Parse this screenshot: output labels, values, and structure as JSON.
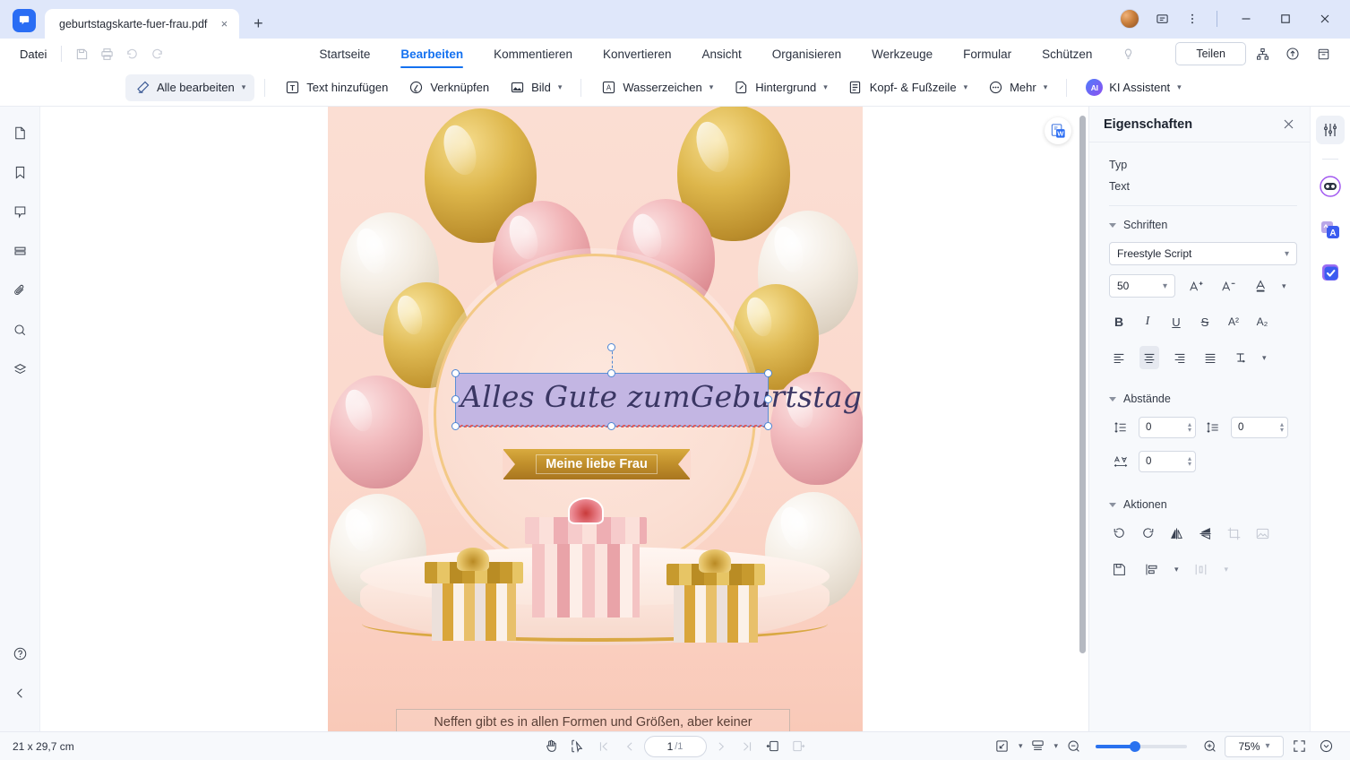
{
  "titlebar": {
    "tab_title": "geburtstagskarte-fuer-frau.pdf",
    "close_tab": "×",
    "new_tab": "+",
    "icons": [
      "avatar",
      "comment-icon",
      "more-vertical-icon",
      "minimize-icon",
      "maximize-icon",
      "close-icon"
    ]
  },
  "menubar": {
    "file_label": "Datei",
    "quick_icons": [
      "save-icon",
      "print-icon",
      "undo-icon",
      "redo-icon"
    ],
    "tabs": [
      {
        "label": "Startseite",
        "active": false
      },
      {
        "label": "Bearbeiten",
        "active": true
      },
      {
        "label": "Kommentieren",
        "active": false
      },
      {
        "label": "Konvertieren",
        "active": false
      },
      {
        "label": "Ansicht",
        "active": false
      },
      {
        "label": "Organisieren",
        "active": false
      },
      {
        "label": "Werkzeuge",
        "active": false
      },
      {
        "label": "Formular",
        "active": false
      },
      {
        "label": "Schützen",
        "active": false
      }
    ],
    "bulb_icon": "lightbulb-icon",
    "share_label": "Teilen",
    "right_icons": [
      "share-network-icon",
      "cloud-upload-icon",
      "archive-icon"
    ]
  },
  "ribbon": {
    "items": [
      {
        "label": "Alle bearbeiten",
        "icon": "edit-pencil-icon",
        "caret": true,
        "active": true
      },
      {
        "label": "Text hinzufügen",
        "icon": "add-text-icon",
        "caret": false,
        "active": false
      },
      {
        "label": "Verknüpfen",
        "icon": "link-icon",
        "caret": false,
        "active": false
      },
      {
        "label": "Bild",
        "icon": "image-icon",
        "caret": true,
        "active": false
      },
      {
        "label": "Wasserzeichen",
        "icon": "watermark-icon",
        "caret": true,
        "active": false
      },
      {
        "label": "Hintergrund",
        "icon": "background-icon",
        "caret": true,
        "active": false
      },
      {
        "label": "Kopf- & Fußzeile",
        "icon": "header-footer-icon",
        "caret": true,
        "active": false
      },
      {
        "label": "Mehr",
        "icon": "more-dots-icon",
        "caret": true,
        "active": false
      }
    ],
    "ai_label": "KI Assistent",
    "ai_badge": "AI"
  },
  "leftrail": {
    "icons": [
      "page-thumbnail-icon",
      "bookmark-icon",
      "comment-icon",
      "list-icon",
      "attachment-icon",
      "search-icon",
      "layers-icon"
    ],
    "help_icon": "help-icon",
    "collapse_icon": "chevron-left-icon"
  },
  "document": {
    "word_badge": "word-convert-icon",
    "heading_text": "Alles Gute zumGeburtstag",
    "banner_text": "Meine liebe Frau",
    "bottom_text": "Neffen gibt es in allen Formen und Größen, aber keiner"
  },
  "properties": {
    "title": "Eigenschaften",
    "close_icon": "close-icon",
    "type_label": "Typ",
    "type_value": "Text",
    "fonts": {
      "section_title": "Schriften",
      "font_family": "Freestyle Script",
      "font_size": "50",
      "increase_icon": "increase-font-icon",
      "decrease_icon": "decrease-font-icon",
      "color_icon": "font-color-icon",
      "style_buttons": [
        {
          "name": "bold-button",
          "glyph": "B"
        },
        {
          "name": "italic-button",
          "glyph": "I"
        },
        {
          "name": "underline-button",
          "glyph": "U"
        },
        {
          "name": "strikethrough-button",
          "glyph": "S"
        },
        {
          "name": "superscript-button",
          "glyph": "A²"
        },
        {
          "name": "subscript-button",
          "glyph": "A₂"
        }
      ],
      "align_buttons": [
        {
          "name": "align-left-button",
          "active": false
        },
        {
          "name": "align-center-button",
          "active": true
        },
        {
          "name": "align-right-button",
          "active": false
        },
        {
          "name": "align-justify-button",
          "active": false
        },
        {
          "name": "text-direction-button",
          "active": false
        }
      ]
    },
    "spacing": {
      "section_title": "Abstände",
      "line_spacing": "0",
      "paragraph_spacing": "0",
      "character_spacing": "0"
    },
    "actions": {
      "section_title": "Aktionen",
      "buttons": [
        {
          "name": "rotate-left-button",
          "disabled": false
        },
        {
          "name": "rotate-right-button",
          "disabled": false
        },
        {
          "name": "flip-horizontal-button",
          "disabled": false
        },
        {
          "name": "flip-vertical-button",
          "disabled": false
        },
        {
          "name": "crop-button",
          "disabled": true
        },
        {
          "name": "replace-image-button",
          "disabled": true
        },
        {
          "name": "save-object-button",
          "disabled": false
        },
        {
          "name": "align-objects-button",
          "disabled": false
        },
        {
          "name": "distribute-objects-button",
          "disabled": true
        }
      ]
    }
  },
  "rightrail": {
    "icons": [
      "properties-panel-icon",
      "ai-assistant-icon",
      "translate-icon",
      "checklist-icon"
    ]
  },
  "statusbar": {
    "page_size": "21 x 29,7 cm",
    "hand_tool": "hand-tool-icon",
    "select_tool": "select-tool-icon",
    "first_page": "first-page-icon",
    "prev_page": "prev-page-icon",
    "current_page": "1",
    "total_pages": "/1",
    "next_page": "next-page-icon",
    "last_page": "last-page-icon",
    "single_page_icon": "single-page-view-icon",
    "facing_page_icon": "facing-page-view-icon",
    "fit_icon": "fit-page-icon",
    "layout_icon": "page-layout-icon",
    "zoom_out": "zoom-out-icon",
    "zoom_in": "zoom-in-icon",
    "zoom_level": "75%",
    "fullscreen": "fullscreen-icon",
    "collapse": "collapse-icon"
  }
}
